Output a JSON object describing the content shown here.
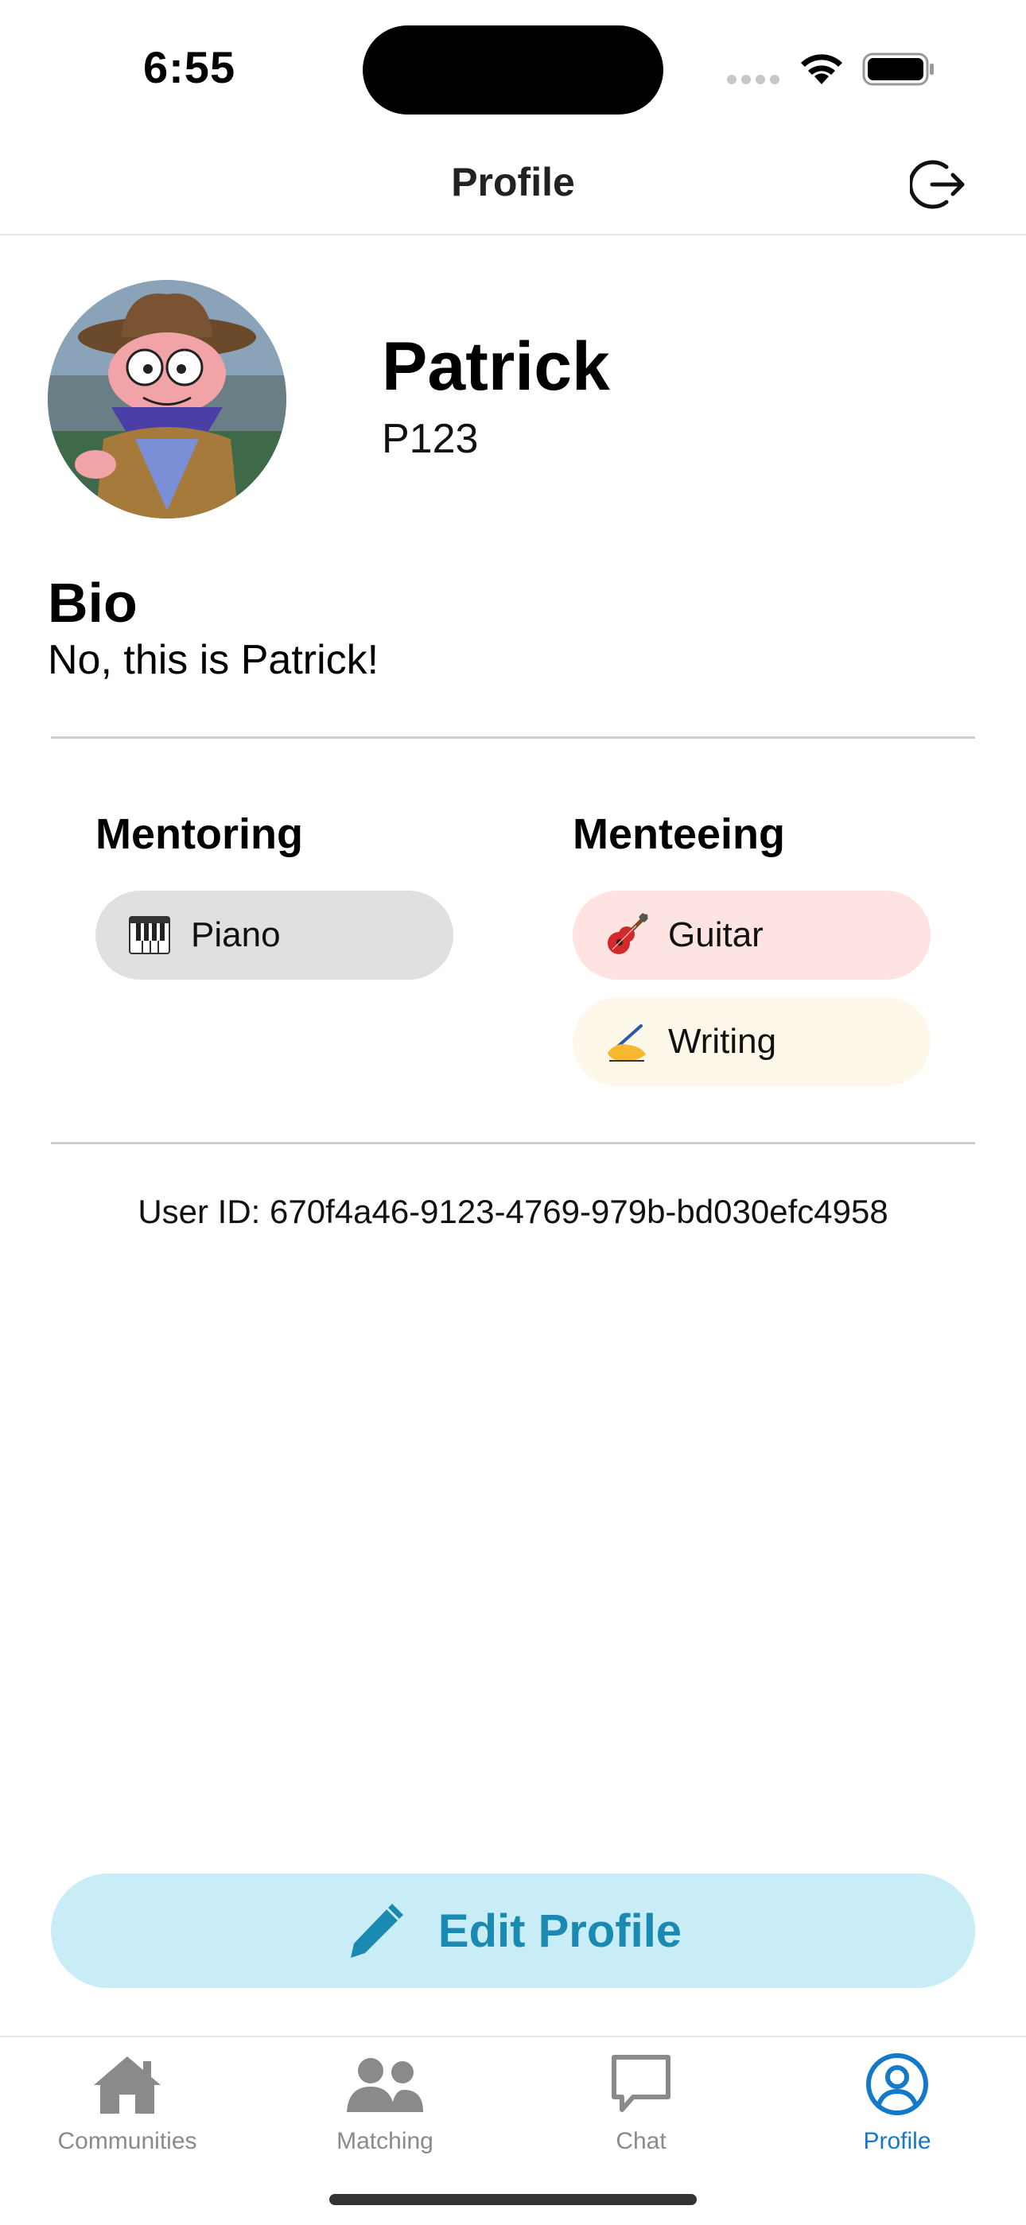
{
  "status_bar": {
    "time": "6:55"
  },
  "nav": {
    "title": "Profile",
    "logout_icon": "logout-icon"
  },
  "profile": {
    "name": "Patrick",
    "username": "P123",
    "bio_heading": "Bio",
    "bio": "No, this is Patrick!"
  },
  "mentoring": {
    "heading": "Mentoring",
    "items": [
      {
        "emoji_icon": "piano-icon",
        "label": "Piano",
        "color": "#e0e0e0"
      }
    ]
  },
  "menteeing": {
    "heading": "Menteeing",
    "items": [
      {
        "emoji_icon": "guitar-icon",
        "label": "Guitar",
        "color": "#fde4e2"
      },
      {
        "emoji_icon": "writing-hand-icon",
        "label": "Writing",
        "color": "#fef8ea"
      }
    ]
  },
  "user_id": "User ID: 670f4a46-9123-4769-979b-bd030efc4958",
  "edit_button": {
    "label": "Edit Profile",
    "icon": "pencil-icon",
    "color": "#c8edf7"
  },
  "tabs": [
    {
      "label": "Communities",
      "icon": "home-icon"
    },
    {
      "label": "Matching",
      "icon": "people-icon"
    },
    {
      "label": "Chat",
      "icon": "chat-bubble-icon"
    },
    {
      "label": "Profile",
      "icon": "profile-circle-icon",
      "active": true
    }
  ],
  "colors": {
    "accent": "#1479c9",
    "button_text": "#1a8ab3"
  }
}
